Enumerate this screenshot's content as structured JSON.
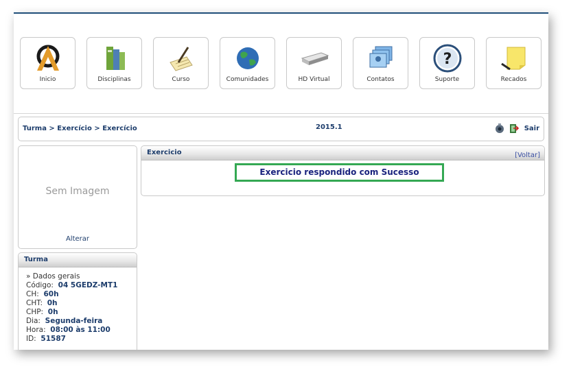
{
  "toolbar": {
    "items": [
      {
        "label": "Inicio",
        "icon": "home-logo-icon"
      },
      {
        "label": "Disciplinas",
        "icon": "books-icon"
      },
      {
        "label": "Curso",
        "icon": "pen-paper-icon"
      },
      {
        "label": "Comunidades",
        "icon": "globe-icon"
      },
      {
        "label": "HD Virtual",
        "icon": "hard-drive-icon"
      },
      {
        "label": "Contatos",
        "icon": "contacts-icon"
      },
      {
        "label": "Suporte",
        "icon": "help-icon"
      },
      {
        "label": "Recados",
        "icon": "sticky-note-icon"
      }
    ]
  },
  "breadcrumb": {
    "text": "Turma > Exercício > Exercício"
  },
  "term": "2015.1",
  "header_actions": {
    "logout_label": "Sair"
  },
  "profile": {
    "no_image_text": "Sem Imagem",
    "change_label": "Alterar"
  },
  "turma": {
    "title": "Turma",
    "section": "» Dados gerais",
    "fields": [
      {
        "label": "Código:",
        "value": "04 5GEDZ-MT1"
      },
      {
        "label": "CH:",
        "value": "60h"
      },
      {
        "label": "CHT:",
        "value": "0h"
      },
      {
        "label": "CHP:",
        "value": "0h"
      },
      {
        "label": "Dia:",
        "value": "Segunda-feira"
      },
      {
        "label": "Hora:",
        "value": "08:00 às 11:00"
      },
      {
        "label": "ID:",
        "value": "51587"
      }
    ]
  },
  "main": {
    "title": "Exercicio",
    "back_label": "[Voltar]",
    "message": "Exercicio respondido com Sucesso"
  },
  "colors": {
    "accent": "#1c3c6b",
    "success_border": "#34a853"
  }
}
